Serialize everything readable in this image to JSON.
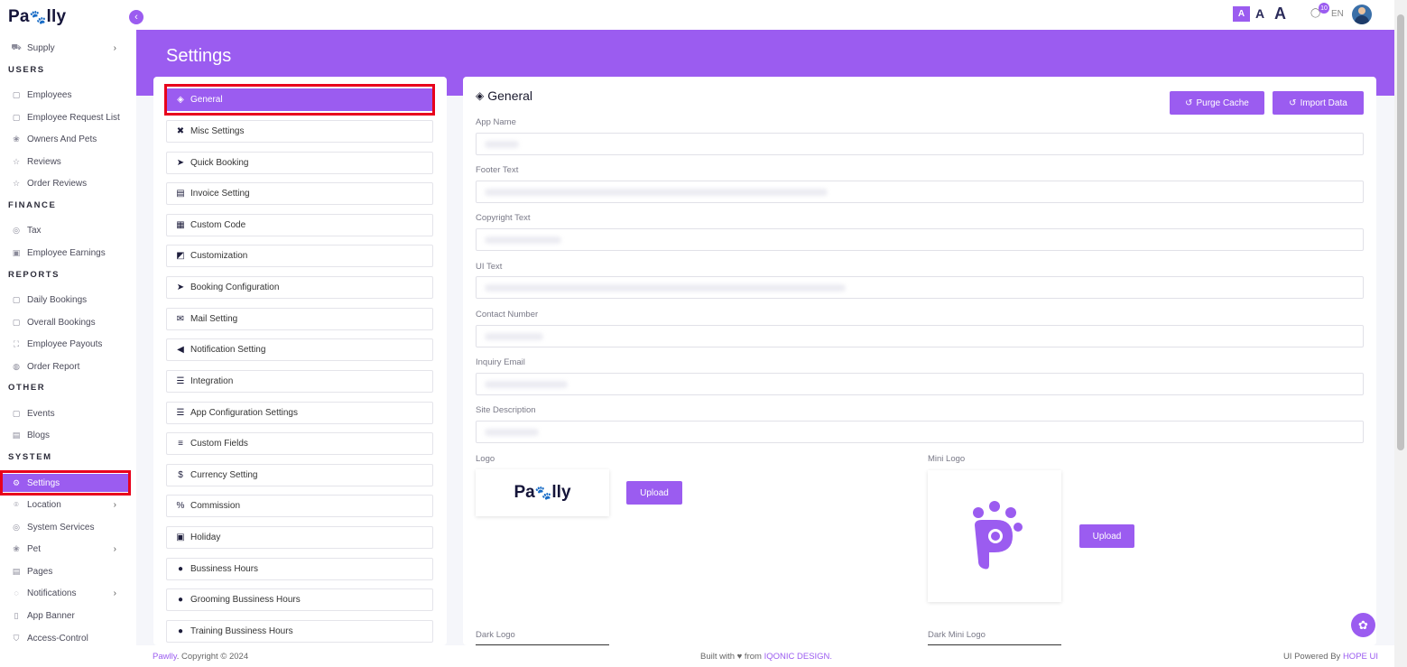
{
  "brand": {
    "name_pre": "Pa",
    "name_post": "lly"
  },
  "sidebar": {
    "items": [
      {
        "label": "Supply",
        "icon": "truck-icon",
        "has_chevron": true
      },
      {
        "section": "USERS"
      },
      {
        "label": "Employees",
        "icon": "calendar-icon"
      },
      {
        "label": "Employee Request List",
        "icon": "calendar-icon"
      },
      {
        "label": "Owners And Pets",
        "icon": "paw-icon"
      },
      {
        "label": "Reviews",
        "icon": "star-icon"
      },
      {
        "label": "Order Reviews",
        "icon": "star-icon"
      },
      {
        "section": "FINANCE"
      },
      {
        "label": "Tax",
        "icon": "circle-icon"
      },
      {
        "label": "Employee Earnings",
        "icon": "wallet-icon"
      },
      {
        "section": "REPORTS"
      },
      {
        "label": "Daily Bookings",
        "icon": "calendar-icon"
      },
      {
        "label": "Overall Bookings",
        "icon": "calendar-icon"
      },
      {
        "label": "Employee Payouts",
        "icon": "scan-icon"
      },
      {
        "label": "Order Report",
        "icon": "globe-icon"
      },
      {
        "section": "OTHER"
      },
      {
        "label": "Events",
        "icon": "calendar-icon"
      },
      {
        "label": "Blogs",
        "icon": "document-icon"
      },
      {
        "section": "SYSTEM"
      },
      {
        "label": "Settings",
        "icon": "gear-icon",
        "active": true
      },
      {
        "label": "Location",
        "icon": "location-pin-icon",
        "has_chevron": true
      },
      {
        "label": "System Services",
        "icon": "circle-icon"
      },
      {
        "label": "Pet",
        "icon": "paw-icon",
        "has_chevron": true
      },
      {
        "label": "Pages",
        "icon": "document-icon"
      },
      {
        "label": "Notifications",
        "icon": "bell-icon",
        "has_chevron": true
      },
      {
        "label": "App Banner",
        "icon": "mobile-icon"
      },
      {
        "label": "Access-Control",
        "icon": "shield-icon"
      }
    ]
  },
  "topbar": {
    "font_small": "A",
    "font_mid": "A",
    "font_large": "A",
    "notification_count": "10",
    "language": "EN"
  },
  "page": {
    "title": "Settings"
  },
  "settings_menu": {
    "items": [
      {
        "label": "General",
        "icon": "box-icon",
        "active": true
      },
      {
        "label": "Misc Settings",
        "icon": "tools-icon"
      },
      {
        "label": "Quick Booking",
        "icon": "paper-plane-icon"
      },
      {
        "label": "Invoice Setting",
        "icon": "document-icon"
      },
      {
        "label": "Custom Code",
        "icon": "code-file-icon"
      },
      {
        "label": "Customization",
        "icon": "palette-icon"
      },
      {
        "label": "Booking Configuration",
        "icon": "paper-plane-icon"
      },
      {
        "label": "Mail Setting",
        "icon": "envelope-icon"
      },
      {
        "label": "Notification Setting",
        "icon": "megaphone-icon"
      },
      {
        "label": "Integration",
        "icon": "sliders-icon"
      },
      {
        "label": "App Configuration Settings",
        "icon": "sliders-icon"
      },
      {
        "label": "Custom Fields",
        "icon": "list-icon"
      },
      {
        "label": "Currency Setting",
        "icon": "dollar-icon"
      },
      {
        "label": "Commission",
        "icon": "percent-icon"
      },
      {
        "label": "Holiday",
        "icon": "calendar-icon"
      },
      {
        "label": "Bussiness Hours",
        "icon": "clock-icon"
      },
      {
        "label": "Grooming Bussiness Hours",
        "icon": "clock-icon"
      },
      {
        "label": "Training Bussiness Hours",
        "icon": "clock-icon"
      }
    ]
  },
  "form": {
    "title": "General",
    "purge_cache_label": "Purge Cache",
    "import_data_label": "Import Data",
    "fields": {
      "app_name": "App Name",
      "footer_text": "Footer Text",
      "copyright_text": "Copyright Text",
      "ui_text": "UI Text",
      "contact_number": "Contact Number",
      "inquiry_email": "Inquiry Email",
      "site_description": "Site Description"
    },
    "logo_label": "Logo",
    "mini_logo_label": "Mini Logo",
    "dark_logo_label": "Dark Logo",
    "dark_mini_logo_label": "Dark Mini Logo",
    "upload_label": "Upload"
  },
  "footer": {
    "brand": "Pawlly",
    "copyright": ". Copyright © 2024",
    "built_with": "Built with ♥ from ",
    "company": "IQONIC DESIGN.",
    "powered_by": "UI Powered By ",
    "ui_name": "HOPE UI"
  },
  "colors": {
    "accent": "#9b5cf0",
    "highlight": "#e8001c"
  }
}
